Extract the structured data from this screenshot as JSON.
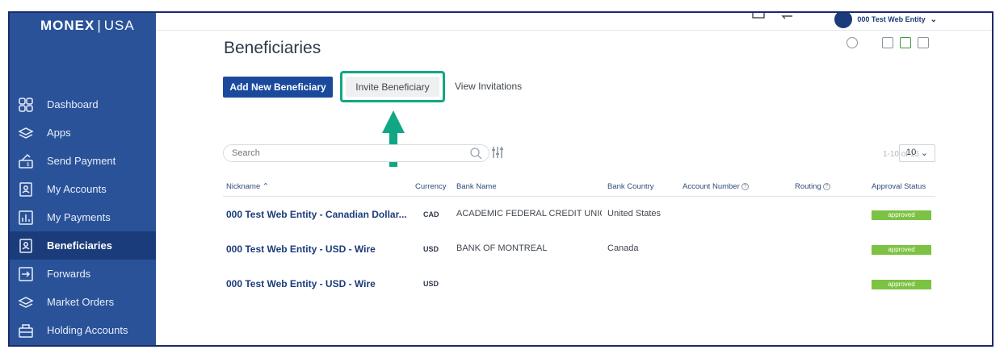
{
  "brand": {
    "logo_left": "MONEX",
    "logo_right": "USA"
  },
  "user": {
    "name": "000 Test Web Entity"
  },
  "sidebar": {
    "items": [
      {
        "label": "Dashboard",
        "icon": "grid-icon"
      },
      {
        "label": "Apps",
        "icon": "layers-icon"
      },
      {
        "label": "Send Payment",
        "icon": "send-money-icon"
      },
      {
        "label": "My Accounts",
        "icon": "account-card-icon"
      },
      {
        "label": "My Payments",
        "icon": "bar-chart-icon"
      },
      {
        "label": "Beneficiaries",
        "icon": "beneficiary-card-icon",
        "active": true
      },
      {
        "label": "Forwards",
        "icon": "arrow-right-box-icon"
      },
      {
        "label": "Market Orders",
        "icon": "layers-icon"
      },
      {
        "label": "Holding Accounts",
        "icon": "briefcase-icon"
      }
    ]
  },
  "page": {
    "title": "Beneficiaries"
  },
  "actions": {
    "add_label": "Add New Beneficiary",
    "invite_label": "Invite Beneficiary",
    "view_label": "View Invitations"
  },
  "search": {
    "placeholder": "Search"
  },
  "paging": {
    "range": "1-10 of 15",
    "per_page": "10"
  },
  "table": {
    "headers": {
      "nickname": "Nickname",
      "currency": "Currency",
      "bank_name": "Bank Name",
      "bank_country": "Bank Country",
      "account_number": "Account Number",
      "routing": "Routing",
      "approval_status": "Approval Status"
    },
    "rows": [
      {
        "nickname": "000 Test Web Entity - Canadian Dollar...",
        "currency": "CAD",
        "bank_name": "ACADEMIC FEDERAL CREDIT UNIO...",
        "bank_country": "United States",
        "status": "approved"
      },
      {
        "nickname": "000 Test Web Entity - USD - Wire",
        "currency": "USD",
        "bank_name": "BANK OF MONTREAL",
        "bank_country": "Canada",
        "status": "approved"
      },
      {
        "nickname": "000 Test Web Entity - USD - Wire",
        "currency": "USD",
        "bank_name": "",
        "bank_country": "",
        "status": "approved"
      }
    ]
  },
  "colors": {
    "sidebar": "#2a5298",
    "primary": "#1b4a9c",
    "highlight": "#12a784",
    "approved": "#7cc243"
  }
}
